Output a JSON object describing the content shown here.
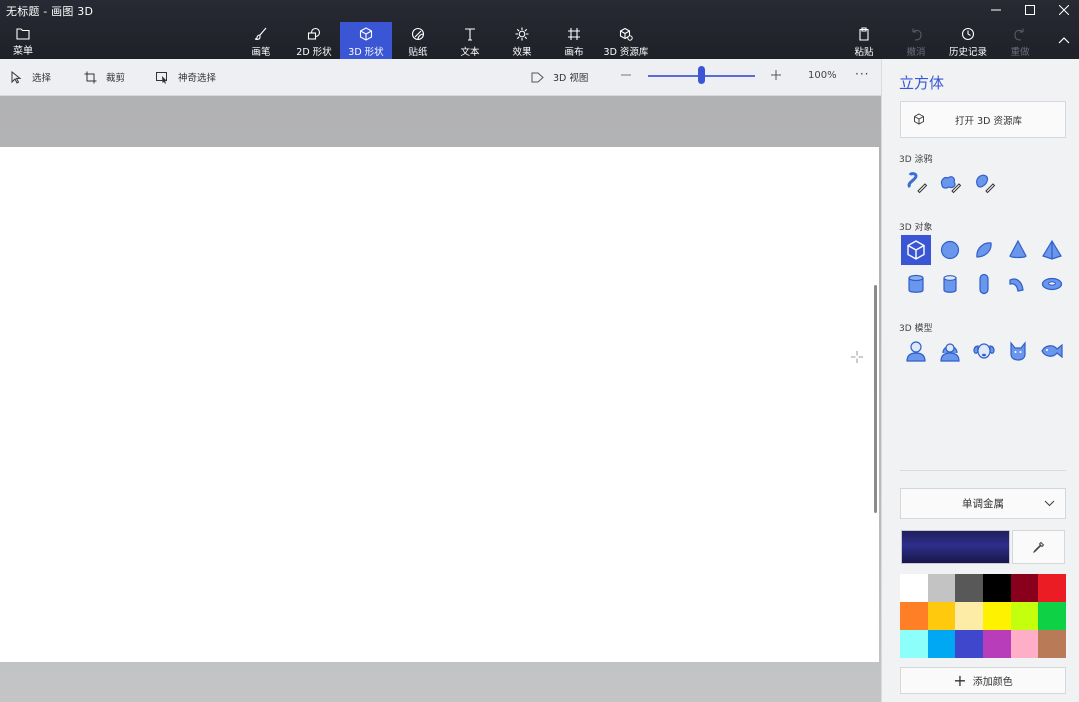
{
  "window": {
    "title": "无标题 - 画图 3D"
  },
  "ribbon": {
    "menu_label": "菜单",
    "tools": [
      {
        "label": "画笔",
        "icon": "brush-icon"
      },
      {
        "label": "2D 形状",
        "icon": "2d-shapes-icon"
      },
      {
        "label": "3D 形状",
        "icon": "3d-shapes-icon",
        "active": true
      },
      {
        "label": "贴纸",
        "icon": "sticker-icon"
      },
      {
        "label": "文本",
        "icon": "text-icon"
      },
      {
        "label": "效果",
        "icon": "effects-icon"
      },
      {
        "label": "画布",
        "icon": "canvas-icon"
      },
      {
        "label": "3D 资源库",
        "icon": "3d-library-icon"
      }
    ],
    "right_tools": [
      {
        "label": "粘贴",
        "icon": "paste-icon",
        "enabled": true
      },
      {
        "label": "撤消",
        "icon": "undo-icon",
        "enabled": false
      },
      {
        "label": "历史记录",
        "icon": "history-icon",
        "enabled": true
      },
      {
        "label": "重做",
        "icon": "redo-icon",
        "enabled": false
      }
    ]
  },
  "subbar": {
    "select_label": "选择",
    "crop_label": "裁剪",
    "magic_select_label": "神奇选择",
    "view3d_label": "3D 视图",
    "zoom_percent": "100%",
    "zoom_level": 0.5
  },
  "panel": {
    "title": "立方体",
    "open_library": "打开 3D 资源库",
    "doodle_section": "3D 涂鸦",
    "objects_section": "3D 对象",
    "models_section": "3D 模型",
    "material": "单调金属",
    "current_color": "#24256b",
    "add_color": "添加颜色",
    "palette": [
      "#ffffff",
      "#c3c3c3",
      "#585858",
      "#000000",
      "#88001b",
      "#ec1c24",
      "#ff7f27",
      "#ffc90e",
      "#fdeca6",
      "#fff200",
      "#c4ff0e",
      "#0ed145",
      "#8cfffb",
      "#00a8f3",
      "#3f48cc",
      "#b83dba",
      "#ffaec8",
      "#b97a57"
    ]
  },
  "colors": {
    "accent": "#3a56d4",
    "ribbon_bg": "#22242c"
  }
}
